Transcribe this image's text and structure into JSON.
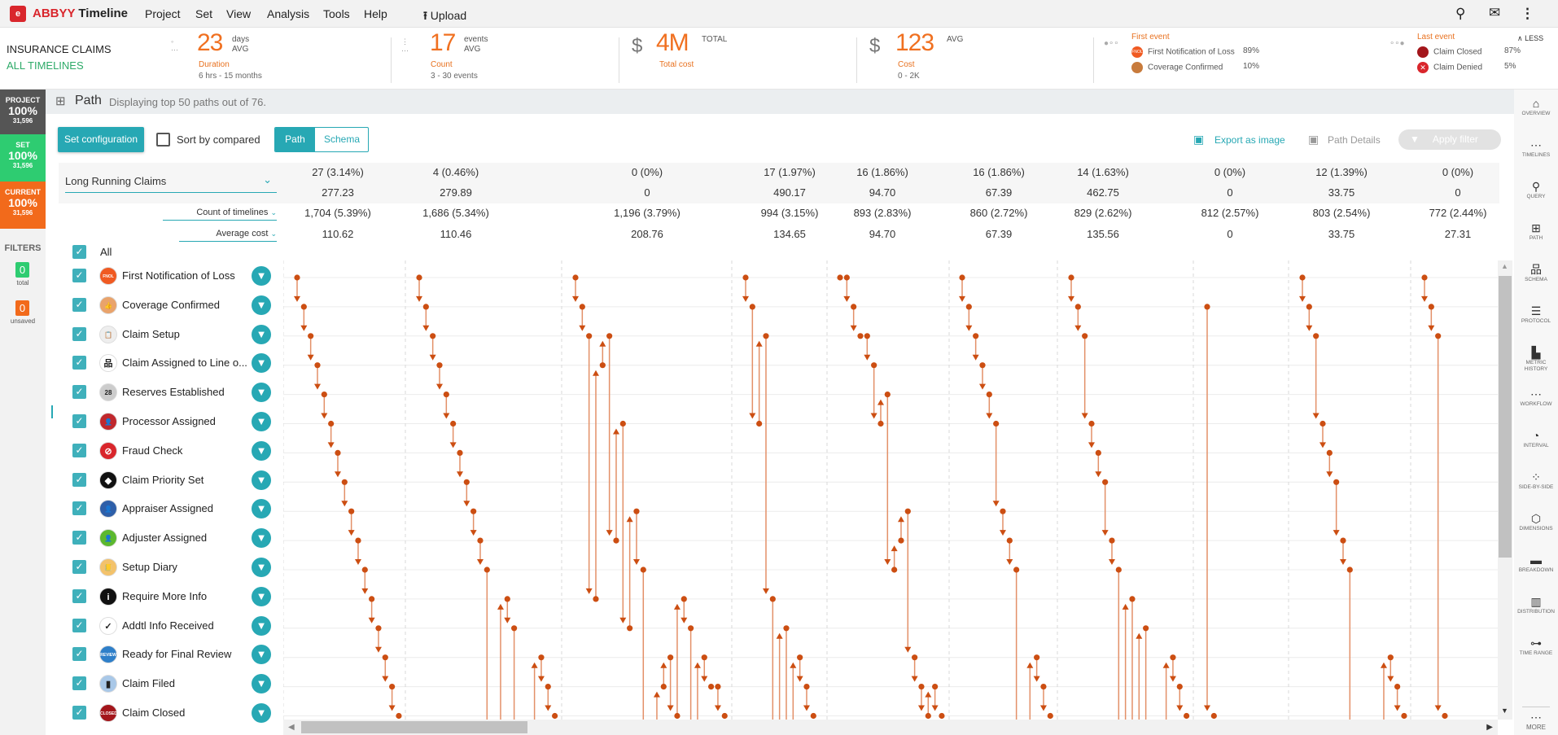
{
  "app": {
    "logo_text": "ABBYY",
    "brand_abbyy": "ABBYY",
    "brand_name": " Timeline"
  },
  "menu": [
    "Project",
    "Set",
    "View",
    "Analysis",
    "Tools",
    "Help"
  ],
  "upload": "Upload",
  "toolbar_icons": [
    "search-icon",
    "mail-icon",
    "more-vertical-icon"
  ],
  "project": {
    "title": "INSURANCE CLAIMS",
    "subtitle": "ALL TIMELINES"
  },
  "stats": {
    "duration": {
      "value": "23",
      "unit1": "days",
      "unit2": "AVG",
      "label": "Duration",
      "range": "6 hrs - 15 months"
    },
    "count": {
      "value": "17",
      "unit1": "events",
      "unit2": "AVG",
      "label": "Count",
      "range": "3 - 30 events"
    },
    "total_cost": {
      "symbol": "$",
      "value": "4M",
      "unit1": "TOTAL",
      "label": "Total cost"
    },
    "cost": {
      "symbol": "$",
      "value": "123",
      "unit1": "AVG",
      "label": "Cost",
      "range": "0 - 2K"
    },
    "first_event": {
      "label": "First event",
      "items": [
        {
          "name": "First Notification of Loss",
          "pct": "89%",
          "color": "#f05a22",
          "icon": "FNOL"
        },
        {
          "name": "Coverage Confirmed",
          "pct": "10%",
          "color": "#c87b3c",
          "icon": ""
        }
      ]
    },
    "last_event": {
      "label": "Last event",
      "items": [
        {
          "name": "Claim Closed",
          "pct": "87%",
          "color": "#a3161b",
          "icon": ""
        },
        {
          "name": "Claim Denied",
          "pct": "5%",
          "color": "#d9262c",
          "icon": "✕"
        }
      ]
    },
    "less": "LESS"
  },
  "tiles": [
    {
      "label": "PROJECT",
      "pct": "100%",
      "count": "31,596",
      "color": "#555555"
    },
    {
      "label": "SET",
      "pct": "100%",
      "count": "31,596",
      "color": "#2ecc71"
    },
    {
      "label": "CURRENT",
      "pct": "100%",
      "count": "31,596",
      "color": "#f26a1b"
    }
  ],
  "filters": {
    "label": "FILTERS",
    "total": "0",
    "total_label": "total",
    "unsaved": "0",
    "unsaved_label": "unsaved"
  },
  "path": {
    "title": "Path",
    "subtitle": "Displaying top 50 paths out of 76."
  },
  "controls": {
    "set_config": "Set configuration",
    "sort_by_compared": "Sort by compared",
    "tab_path": "Path",
    "tab_schema": "Schema",
    "export": "Export as image",
    "path_details": "Path Details",
    "apply_filter": "Apply filter"
  },
  "compare_select": "Long Running Claims",
  "metric1": "Count of timelines",
  "metric2": "Average cost",
  "columns": [
    {
      "r1": "27 (3.14%)",
      "r2": "277.23",
      "r3": "1,704 (5.39%)",
      "r4": "110.62"
    },
    {
      "r1": "4 (0.46%)",
      "r2": "279.89",
      "r3": "1,686 (5.34%)",
      "r4": "110.46"
    },
    {
      "r1": "0 (0%)",
      "r2": "0",
      "r3": "1,196 (3.79%)",
      "r4": "208.76"
    },
    {
      "r1": "17 (1.97%)",
      "r2": "490.17",
      "r3": "994 (3.15%)",
      "r4": "134.65"
    },
    {
      "r1": "16 (1.86%)",
      "r2": "94.70",
      "r3": "893 (2.83%)",
      "r4": "94.70"
    },
    {
      "r1": "16 (1.86%)",
      "r2": "67.39",
      "r3": "860 (2.72%)",
      "r4": "67.39"
    },
    {
      "r1": "14 (1.63%)",
      "r2": "462.75",
      "r3": "829 (2.62%)",
      "r4": "135.56"
    },
    {
      "r1": "0 (0%)",
      "r2": "0",
      "r3": "812 (2.57%)",
      "r4": "0"
    },
    {
      "r1": "12 (1.39%)",
      "r2": "33.75",
      "r3": "803 (2.54%)",
      "r4": "33.75"
    },
    {
      "r1": "0 (0%)",
      "r2": "0",
      "r3": "772 (2.44%)",
      "r4": "27.31"
    }
  ],
  "all_label": "All",
  "events": [
    {
      "name": "First Notification of Loss",
      "icon": "FNOL",
      "color": "#f05a22"
    },
    {
      "name": "Coverage Confirmed",
      "icon": "👍",
      "color": "#e9a36b"
    },
    {
      "name": "Claim Setup",
      "icon": "📋",
      "color": "#eeeeee"
    },
    {
      "name": "Claim Assigned to Line o...",
      "icon": "品",
      "color": "#ffffff"
    },
    {
      "name": "Reserves Established",
      "icon": "28",
      "color": "#cccccc"
    },
    {
      "name": "Processor Assigned",
      "icon": "👤",
      "color": "#c0282d"
    },
    {
      "name": "Fraud Check",
      "icon": "⊘",
      "color": "#d9262c"
    },
    {
      "name": "Claim Priority Set",
      "icon": "◆",
      "color": "#111111"
    },
    {
      "name": "Appraiser Assigned",
      "icon": "👤",
      "color": "#2f5fa8"
    },
    {
      "name": "Adjuster Assigned",
      "icon": "👤",
      "color": "#5cb82e"
    },
    {
      "name": "Setup Diary",
      "icon": "📒",
      "color": "#f3c26b"
    },
    {
      "name": "Require More Info",
      "icon": "i",
      "color": "#111111"
    },
    {
      "name": "Addtl Info Received",
      "icon": "✓",
      "color": "#ffffff"
    },
    {
      "name": "Ready for Final Review",
      "icon": "REVIEW",
      "color": "#2e7fc9"
    },
    {
      "name": "Claim Filed",
      "icon": "▮",
      "color": "#a9c8e8"
    },
    {
      "name": "Claim Closed",
      "icon": "CLOSED",
      "color": "#a3161b"
    }
  ],
  "chart_data": {
    "type": "path",
    "colors": {
      "line": "#e39068",
      "mark": "#cc4e12"
    },
    "note_rows": "event indices into events; values 18-20 are events below the visible list",
    "paths": [
      [
        0,
        1,
        2,
        3,
        4,
        5,
        6,
        7,
        8,
        9,
        10,
        11,
        12,
        13,
        14,
        15
      ],
      [
        0,
        1,
        2,
        3,
        4,
        5,
        6,
        7,
        8,
        9,
        10,
        18,
        19,
        11,
        12,
        18,
        19,
        20,
        13,
        14,
        15
      ],
      [
        0,
        1,
        2,
        11,
        3,
        2,
        9,
        5,
        12,
        8,
        10,
        18,
        19,
        14,
        13,
        15,
        11,
        12,
        18,
        13,
        14,
        14,
        15
      ],
      [
        0,
        1,
        5,
        2,
        11,
        18,
        12,
        18,
        13,
        14,
        15
      ],
      [
        0,
        0,
        1,
        2,
        2,
        3,
        5,
        4,
        10,
        9,
        8,
        13,
        14,
        15,
        14,
        15
      ],
      [
        0,
        1,
        2,
        3,
        4,
        5,
        8,
        9,
        10,
        18,
        19,
        13,
        14,
        15
      ],
      [
        0,
        1,
        2,
        5,
        6,
        7,
        9,
        10,
        18,
        11,
        18,
        12,
        18,
        19,
        20,
        13,
        14,
        15
      ],
      [
        1,
        15
      ],
      [
        0,
        1,
        2,
        5,
        6,
        7,
        9,
        10,
        18,
        19,
        18,
        19,
        18,
        13,
        14,
        15
      ],
      [
        0,
        1,
        2,
        15
      ]
    ]
  },
  "sidebar": [
    {
      "label": "OVERVIEW",
      "icon": "⌂"
    },
    {
      "label": "TIMELINES",
      "icon": "⋯"
    },
    {
      "label": "QUERY",
      "icon": "⚲"
    },
    {
      "label": "PATH",
      "icon": "⊞"
    },
    {
      "label": "SCHEMA",
      "icon": "品"
    },
    {
      "label": "PROTOCOL",
      "icon": "☰"
    },
    {
      "label": "METRIC HISTORY",
      "icon": "▙"
    },
    {
      "label": "WORKFLOW",
      "icon": "⋯"
    },
    {
      "label": "INTERVAL",
      "icon": "◔"
    },
    {
      "label": "SIDE-BY-SIDE",
      "icon": "⁘"
    },
    {
      "label": "DIMENSIONS",
      "icon": "⬡"
    },
    {
      "label": "BREAKDOWN",
      "icon": "▬"
    },
    {
      "label": "DISTRIBUTION",
      "icon": "▥"
    },
    {
      "label": "TIME RANGE",
      "icon": "⊶"
    }
  ],
  "more": "MORE"
}
